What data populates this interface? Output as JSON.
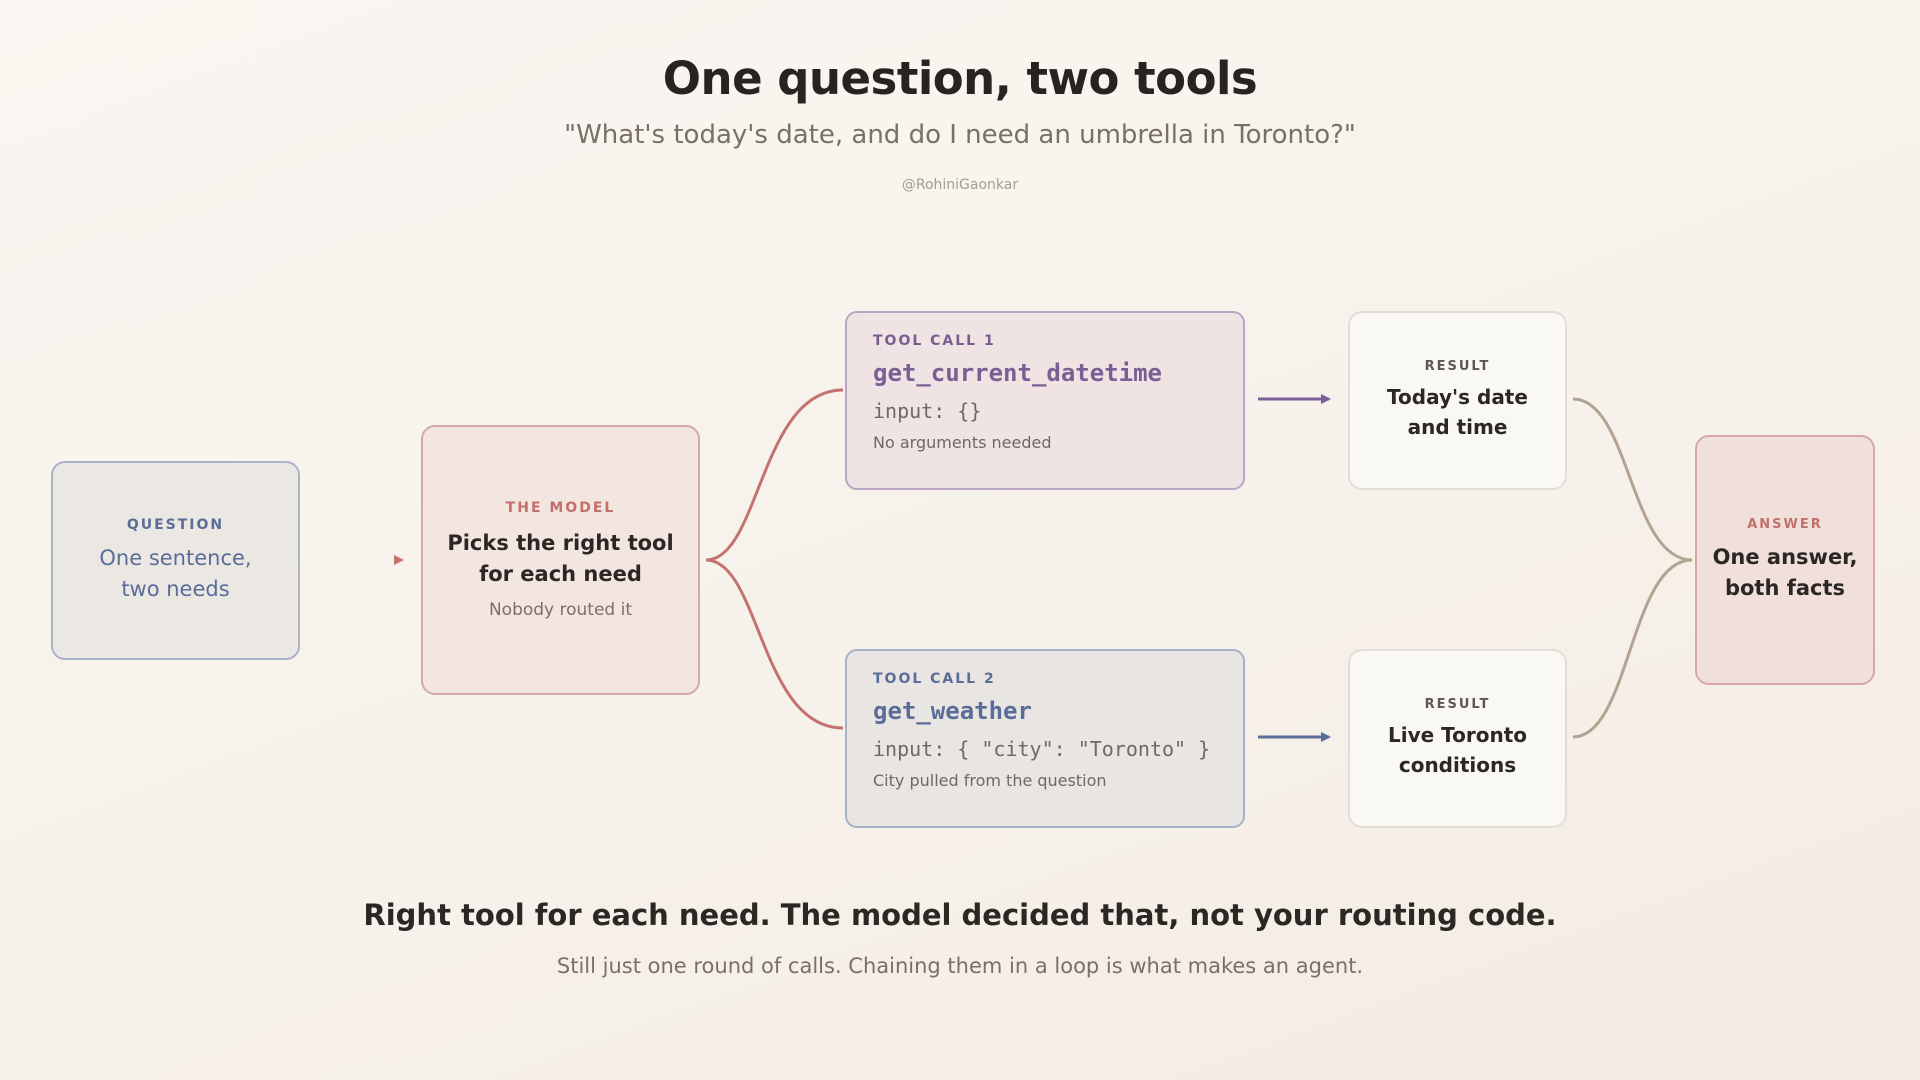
{
  "header": {
    "title": "One question, two tools",
    "subtitle": "\"What's today's date, and do I need an umbrella in Toronto?\"",
    "handle": "@RohiniGaonkar"
  },
  "question": {
    "kicker": "QUESTION",
    "line1": "One sentence,",
    "line2": "two needs"
  },
  "model": {
    "kicker": "THE MODEL",
    "line1": "Picks the right tool",
    "line2": "for each need",
    "note": "Nobody routed it"
  },
  "tool1": {
    "kicker": "TOOL CALL 1",
    "function": "get_current_datetime",
    "input": "input: {}",
    "note": "No arguments needed"
  },
  "tool2": {
    "kicker": "TOOL CALL 2",
    "function": "get_weather",
    "input": "input: { \"city\": \"Toronto\" }",
    "note": "City pulled from the question"
  },
  "result1": {
    "kicker": "RESULT",
    "line1": "Today's date",
    "line2": "and time"
  },
  "result2": {
    "kicker": "RESULT",
    "line1": "Live Toronto",
    "line2": "conditions"
  },
  "answer": {
    "kicker": "ANSWER",
    "line1": "One answer,",
    "line2": "both facts"
  },
  "footer": {
    "main": "Right tool for each need. The model decided that, not your routing code.",
    "sub": "Still just one round of calls. Chaining them in a loop is what makes an agent."
  },
  "colors": {
    "model_accent": "#c4726f",
    "tool1_accent": "#7a5f95",
    "tool2_accent": "#5a6c98",
    "merge_line": "#b3a393"
  }
}
